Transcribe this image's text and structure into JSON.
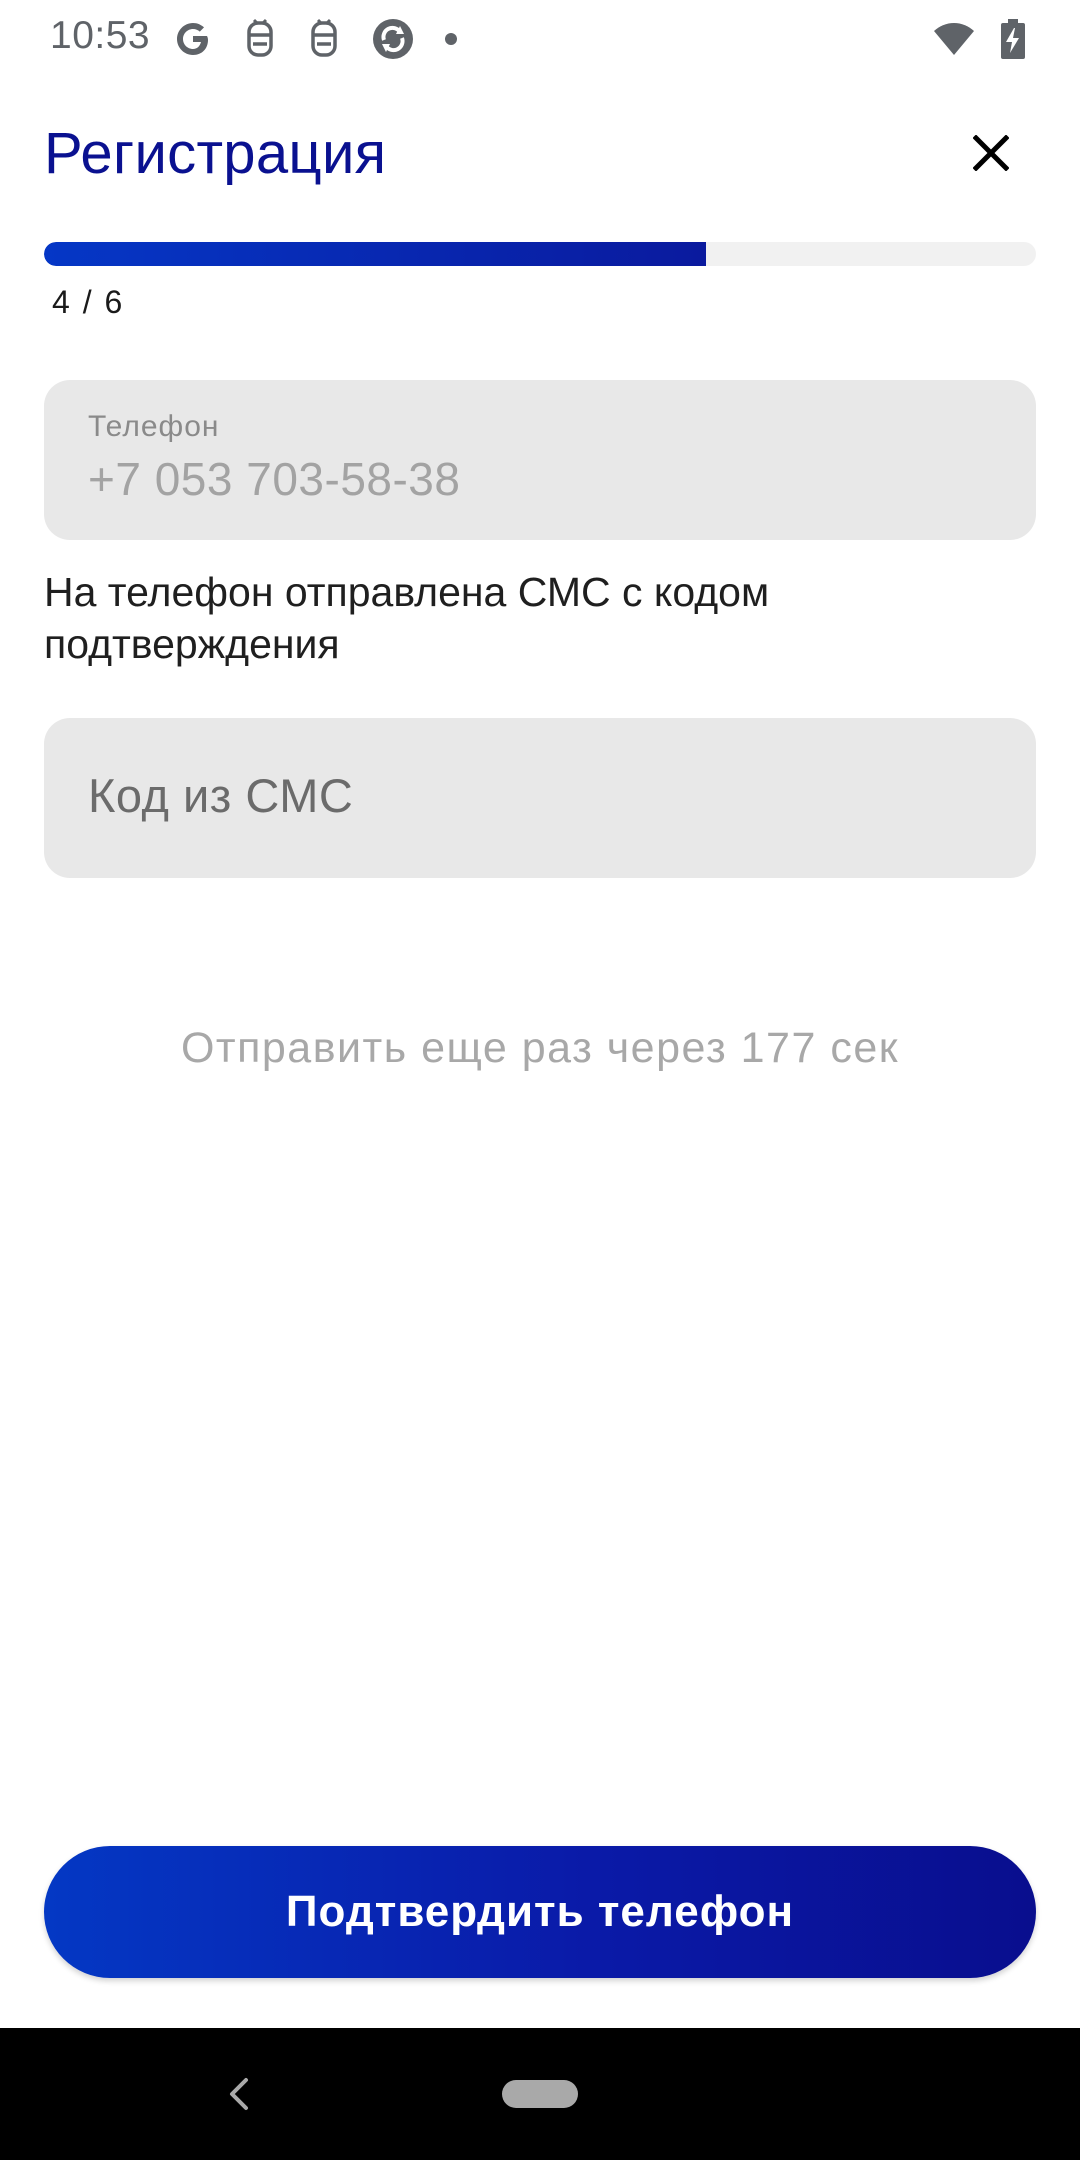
{
  "status_bar": {
    "time": "10:53",
    "left_icons": [
      "google-icon",
      "notification-icon",
      "notification-icon",
      "sync-icon",
      "dot-icon"
    ],
    "right_icons": [
      "wifi-icon",
      "battery-charging-icon"
    ]
  },
  "header": {
    "title": "Регистрация",
    "close_icon": "close-icon"
  },
  "progress": {
    "label": "4 / 6",
    "current_step": 4,
    "total_steps": 6,
    "fill_fraction": 0.667
  },
  "phone_field": {
    "label": "Телефон",
    "value": "+7 053 703-58-38"
  },
  "sms_info": "На телефон отправлена СМС с кодом подтверждения",
  "code_field": {
    "placeholder": "Код из СМС"
  },
  "resend_text": "Отправить еще раз через 177 сек",
  "confirm_button": {
    "label": "Подтвердить телефон"
  },
  "colors": {
    "accent": "#0a1190",
    "button_gradient_start": "#0438c4",
    "button_gradient_end": "#090e8e",
    "field_background": "#e8e8e8"
  }
}
